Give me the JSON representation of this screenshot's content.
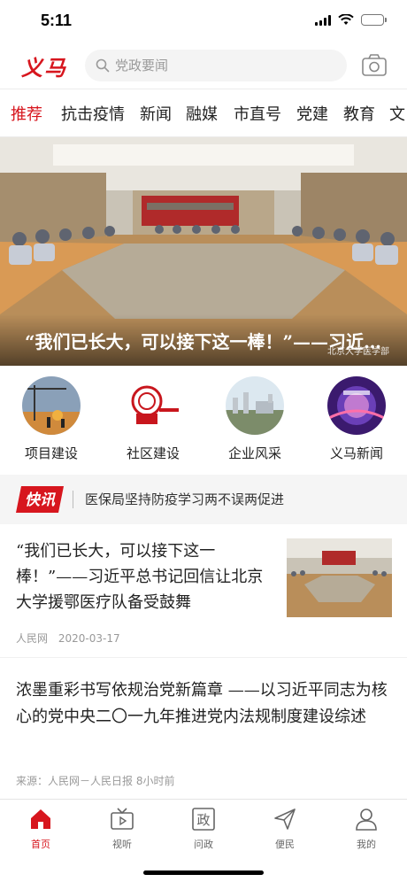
{
  "status_bar": {
    "time": "5:11"
  },
  "header": {
    "logo": "义马",
    "search_placeholder": "党政要闻",
    "icons": {
      "search": "search-icon",
      "camera": "camera-icon"
    }
  },
  "tabs": [
    "推荐",
    "抗击疫情",
    "新闻",
    "融媒",
    "市直号",
    "党建",
    "教育",
    "文"
  ],
  "active_tab": "推荐",
  "banner": {
    "title": "“我们已长大，可以接下这一棒！”——习近平总书记回信让北京大学援鄂医疗队备受鼓舞",
    "watermark": "北京大学医学部"
  },
  "quick_links": [
    {
      "label": "项目建设",
      "icon": "construction-image"
    },
    {
      "label": "社区建设",
      "icon": "community-logo"
    },
    {
      "label": "企业风采",
      "icon": "factory-image"
    },
    {
      "label": "义马新闻",
      "icon": "news-image"
    }
  ],
  "news_flash": {
    "badge": "快讯",
    "text": "医保局坚持防疫学习两不误两促进"
  },
  "articles": [
    {
      "title": "“我们已长大，可以接下这一棒！”——习近平总书记回信让北京大学援鄂医疗队备受鼓舞",
      "source": "人民网",
      "date": "2020-03-17"
    },
    {
      "title": "浓墨重彩书写依规治党新篇章 ——以习近平同志为核心的党中央二〇一九年推进党内法规制度建设综述",
      "meta": "来源：人民网－人民日报 8小时前"
    }
  ],
  "bottom_nav": [
    {
      "label": "首页",
      "icon": "home-icon"
    },
    {
      "label": "视听",
      "icon": "tv-icon"
    },
    {
      "label": "问政",
      "icon": "zheng-icon",
      "glyph": "政"
    },
    {
      "label": "便民",
      "icon": "send-icon"
    },
    {
      "label": "我的",
      "icon": "user-icon"
    }
  ],
  "colors": {
    "accent": "#d7161e",
    "text": "#222222",
    "meta": "#999999"
  }
}
